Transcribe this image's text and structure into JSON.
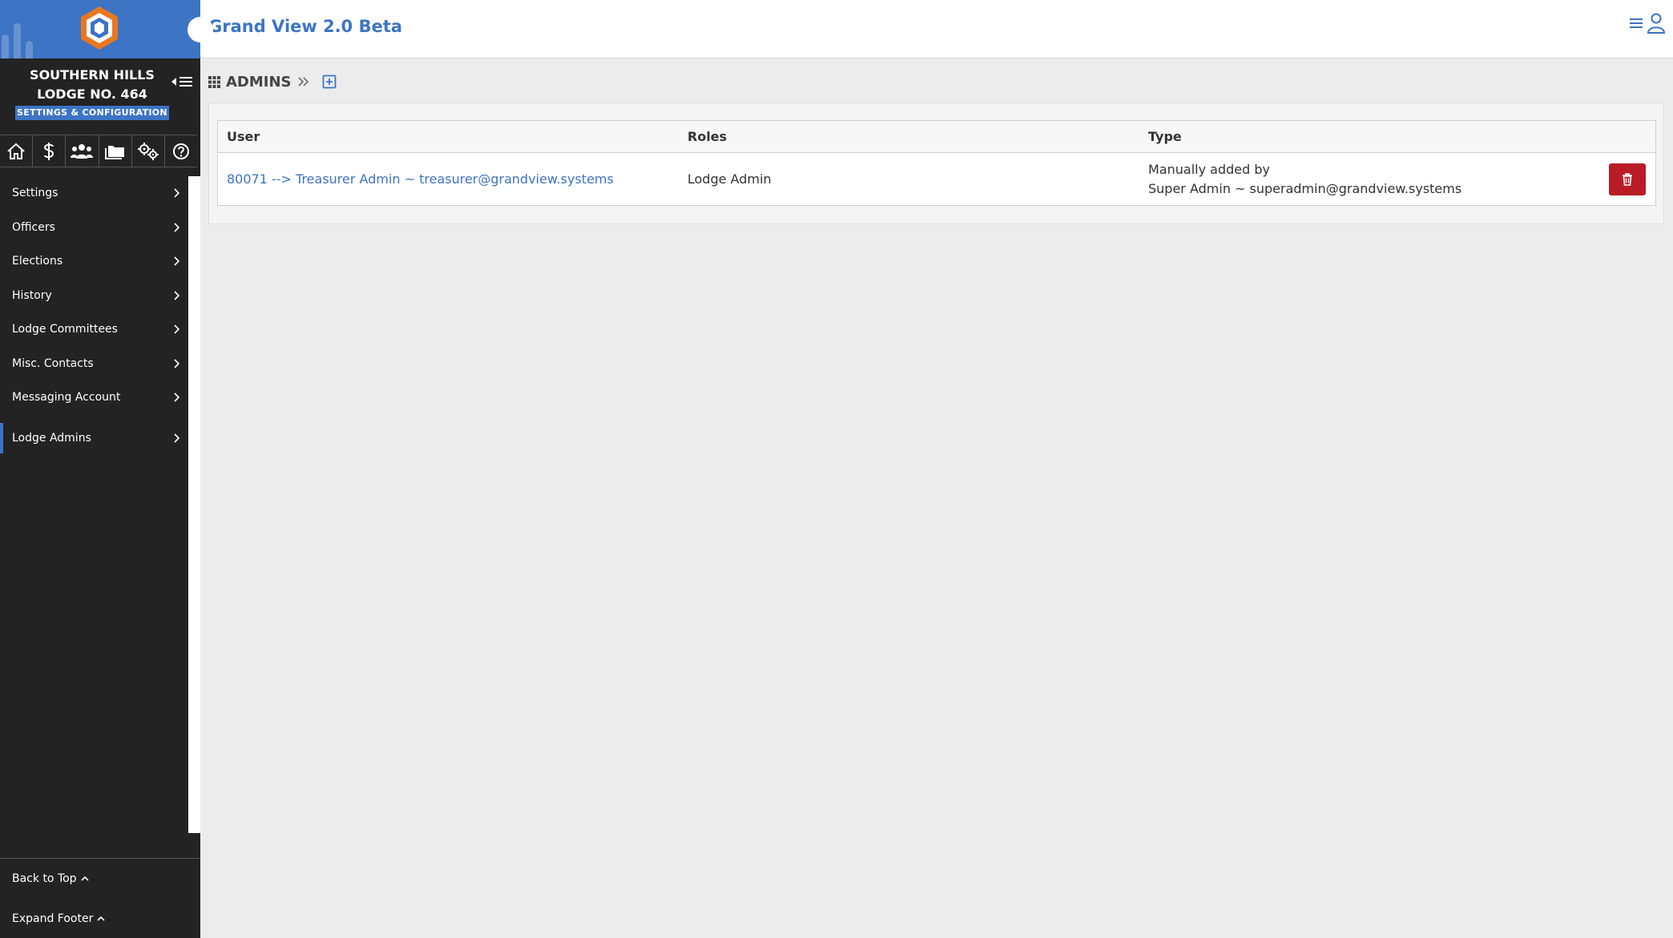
{
  "app": {
    "title": "Grand View 2.0 Beta"
  },
  "sidebar": {
    "lodge_name_line1": "SOUTHERN HILLS",
    "lodge_name_line2": "LODGE NO. 464",
    "section_badge": "SETTINGS & CONFIGURATION",
    "icon_row": [
      "home-icon",
      "dollar-icon",
      "members-icon",
      "folders-icon",
      "gears-icon",
      "help-icon"
    ],
    "items": [
      {
        "label": "Settings"
      },
      {
        "label": "Officers"
      },
      {
        "label": "Elections"
      },
      {
        "label": "History"
      },
      {
        "label": "Lodge Committees"
      },
      {
        "label": "Misc. Contacts"
      },
      {
        "label": "Messaging Account"
      },
      {
        "label": "Lodge Admins",
        "active": true
      }
    ],
    "footer": {
      "back_to_top": "Back to Top",
      "expand_footer": "Expand Footer"
    }
  },
  "breadcrumb": {
    "title": "ADMINS"
  },
  "table": {
    "headers": {
      "user": "User",
      "roles": "Roles",
      "type": "Type"
    },
    "rows": [
      {
        "user": "80071 --> Treasurer Admin ~ treasurer@grandview.systems",
        "roles": "Lodge Admin",
        "type_line1": "Manually added by",
        "type_line2": "Super Admin ~ superadmin@grandview.systems"
      }
    ]
  },
  "colors": {
    "brand_blue": "#3d74c4",
    "sidebar_bg": "#232323",
    "danger": "#b91c25",
    "logo_orange": "#e87722"
  }
}
